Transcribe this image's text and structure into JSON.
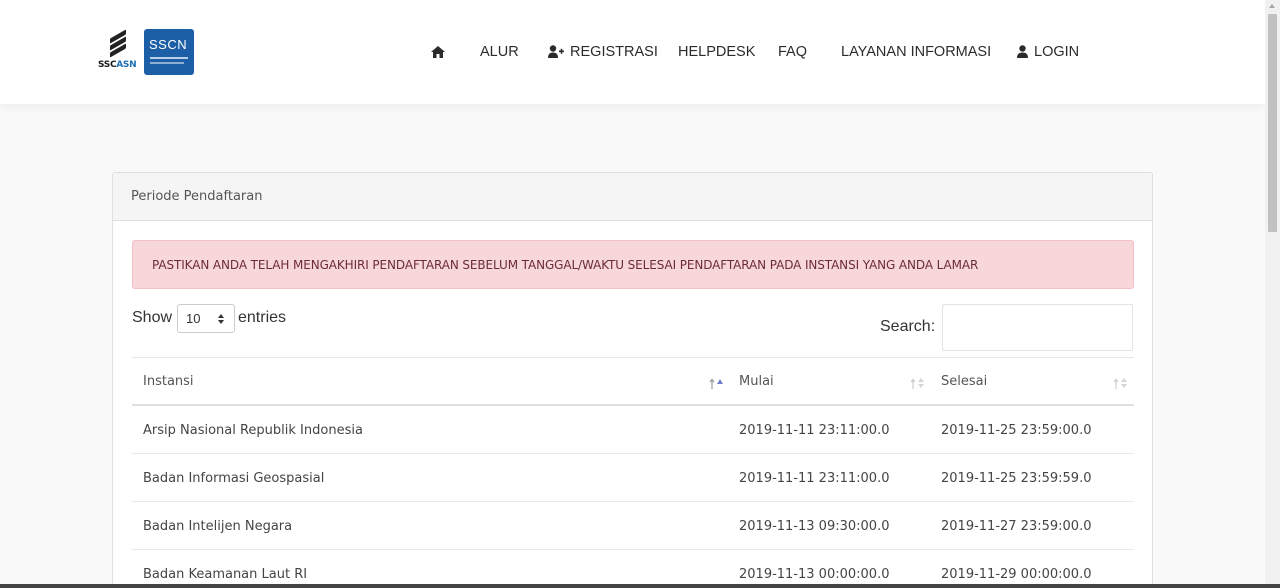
{
  "header": {
    "logo_ssc_text_1": "SSC",
    "logo_ssc_text_2": "ASN",
    "logo_sscn_text": "SSCN",
    "nav": [
      {
        "label": "",
        "icon": "home-icon"
      },
      {
        "label": "ALUR"
      },
      {
        "label": "REGISTRASI",
        "icon": "user-plus-icon"
      },
      {
        "label": "HELPDESK"
      },
      {
        "label": "FAQ"
      },
      {
        "label": "LAYANAN INFORMASI"
      },
      {
        "label": "LOGIN",
        "icon": "user-icon"
      }
    ]
  },
  "card": {
    "title": "Periode Pendaftaran",
    "alert": "PASTIKAN ANDA TELAH MENGAKHIRI PENDAFTARAN SEBELUM TANGGAL/WAKTU SELESAI PENDAFTARAN PADA INSTANSI YANG ANDA LAMAR"
  },
  "controls": {
    "show_label": "Show",
    "entries_value": "10",
    "entries_label": "entries",
    "search_label": "Search:",
    "search_value": ""
  },
  "table": {
    "columns": [
      "Instansi",
      "Mulai",
      "Selesai"
    ],
    "rows": [
      [
        "Arsip Nasional Republik Indonesia",
        "2019-11-11 23:11:00.0",
        "2019-11-25 23:59:00.0"
      ],
      [
        "Badan Informasi Geospasial",
        "2019-11-11 23:11:00.0",
        "2019-11-25 23:59:59.0"
      ],
      [
        "Badan Intelijen Negara",
        "2019-11-13 09:30:00.0",
        "2019-11-27 23:59:00.0"
      ],
      [
        "Badan Keamanan Laut RI",
        "2019-11-13 00:00:00.0",
        "2019-11-29 00:00:00.0"
      ]
    ]
  },
  "colors": {
    "alert_bg": "#f8d7da",
    "sort_active": "#6d7fcc",
    "brand_blue": "#1d5fa6"
  }
}
